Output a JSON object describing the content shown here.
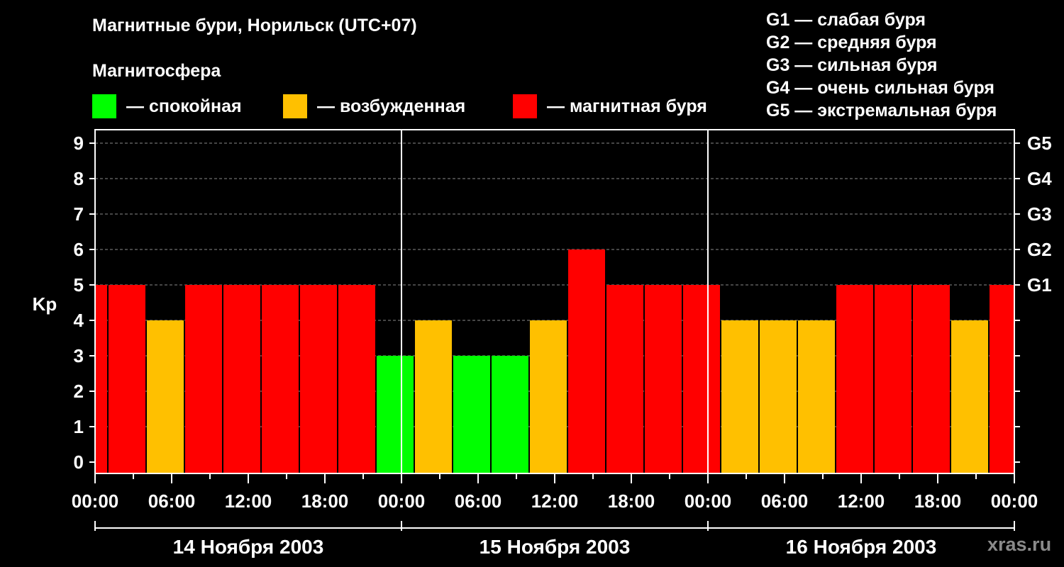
{
  "title": "Магнитные бури, Норильск (UTC+07)",
  "subtitle": "Магнитосфера",
  "legend": [
    {
      "label": "— спокойная",
      "color": "#00ff00"
    },
    {
      "label": "— возбужденная",
      "color": "#ffc000"
    },
    {
      "label": "— магнитная буря",
      "color": "#ff0000"
    }
  ],
  "g_scale": [
    "G1 — слабая буря",
    "G2 — средняя буря",
    "G3 — сильная буря",
    "G4 — очень сильная буря",
    "G5 — экстремальная буря"
  ],
  "watermark": "xras.ru",
  "chart_data": {
    "type": "bar",
    "ylabel": "Kp",
    "ylim": [
      0,
      9
    ],
    "yticks": [
      "0",
      "1",
      "2",
      "3",
      "4",
      "5",
      "6",
      "7",
      "8",
      "9"
    ],
    "right_ticks": [
      {
        "y": 5,
        "label": "G1"
      },
      {
        "y": 6,
        "label": "G2"
      },
      {
        "y": 7,
        "label": "G3"
      },
      {
        "y": 8,
        "label": "G4"
      },
      {
        "y": 9,
        "label": "G5"
      }
    ],
    "x_range_hours": [
      0,
      72
    ],
    "xticks": [
      "00:00",
      "06:00",
      "12:00",
      "18:00",
      "00:00",
      "06:00",
      "12:00",
      "18:00",
      "00:00",
      "06:00",
      "12:00",
      "18:00",
      "00:00"
    ],
    "days": [
      "14 Ноября 2003",
      "15 Ноября 2003",
      "16 Ноября 2003"
    ],
    "bar_interval_hours": 3,
    "bar_start_hours": [
      -2,
      1,
      4,
      7,
      10,
      13,
      16,
      19,
      22,
      25,
      28,
      31,
      34,
      37,
      40,
      43,
      46,
      49,
      52,
      55,
      58,
      61,
      64,
      67,
      70
    ],
    "values": [
      5,
      5,
      4,
      5,
      5,
      5,
      5,
      5,
      3,
      4,
      3,
      3,
      4,
      6,
      5,
      5,
      5,
      4,
      4,
      4,
      5,
      5,
      5,
      4,
      5
    ],
    "colors": {
      "calm": "#00ff00",
      "active": "#ffc000",
      "storm": "#ff0000"
    },
    "grid": true
  }
}
